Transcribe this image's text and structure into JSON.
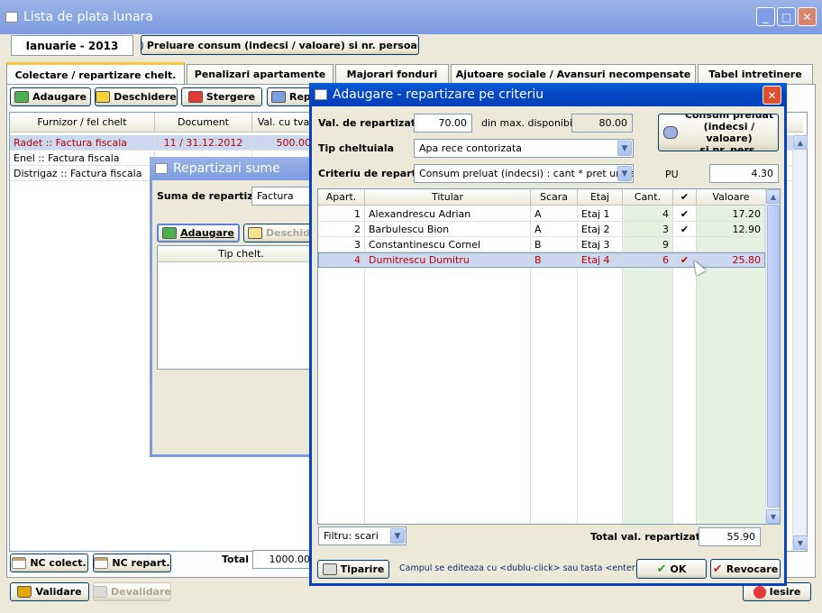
{
  "main_window": {
    "title": "Lista de plata lunara",
    "month": "Ianuarie - 2013",
    "import_button": "Preluare consum (indecsi / valoare) si nr. persoane",
    "tabs": [
      "Colectare / repartizare chelt.",
      "Penalizari apartamente",
      "Majorari fonduri",
      "Ajutoare sociale / Avansuri necompensate",
      "Tabel intretinere"
    ],
    "toolbar": {
      "add": "Adaugare",
      "open": "Deschidere",
      "delete": "Stergere",
      "rep": "Rep"
    },
    "grid": {
      "headers": [
        "Furnizor / fel chelt",
        "Document",
        "Val. cu tva"
      ],
      "rows": [
        {
          "furnizor": "Radet :: Factura fiscala",
          "document": "11 / 31.12.2012",
          "valoare": "500.00"
        },
        {
          "furnizor": "Enel :: Factura fiscala",
          "document": "",
          "valoare": ""
        },
        {
          "furnizor": "Distrigaz :: Factura fiscala",
          "document": "",
          "valoare": ""
        }
      ]
    },
    "bottom": {
      "nc_colect": "NC colect.",
      "nc_repart": "NC repart.",
      "total_label": "Total",
      "total_value": "1000.00",
      "validate": "Validare",
      "devalidate": "Devalidare",
      "exit": "Iesire"
    }
  },
  "sums_dialog": {
    "title": "Repartizari sume",
    "sum_label": "Suma de repartizat",
    "sum_value": "Factura",
    "add": "Adaugare",
    "open": "Deschide",
    "grid_header": "Tip chelt."
  },
  "criteria_dialog": {
    "title": "Adaugare - repartizare pe criteriu",
    "val_label": "Val. de repartizat",
    "val_value": "70.00",
    "max_label": "din max. disponibil",
    "max_value": "80.00",
    "consum_button": "Consum preluat\n(indecsi / valoare)\nsi nr. pers.",
    "tip_label": "Tip cheltuiala",
    "tip_value": "Apa rece contorizata",
    "crit_label": "Criteriu de repart.",
    "crit_value": "Consum preluat (indecsi) : cant * pret unitar",
    "pu_label": "PU",
    "pu_value": "4.30",
    "headers": [
      "Apart.",
      "Titular",
      "Scara",
      "Etaj",
      "Cant.",
      "✔",
      "Valoare"
    ],
    "rows": [
      {
        "apart": "1",
        "titular": "Alexandrescu Adrian",
        "scara": "A",
        "etaj": "Etaj 1",
        "cant": "4",
        "check": "✔",
        "valoare": "17.20"
      },
      {
        "apart": "2",
        "titular": "Barbulescu Bion",
        "scara": "A",
        "etaj": "Etaj 2",
        "cant": "3",
        "check": "✔",
        "valoare": "12.90"
      },
      {
        "apart": "3",
        "titular": "Constantinescu Cornel",
        "scara": "B",
        "etaj": "Etaj 3",
        "cant": "9",
        "check": "",
        "valoare": ""
      },
      {
        "apart": "4",
        "titular": "Dumitrescu Dumitru",
        "scara": "B",
        "etaj": "Etaj 4",
        "cant": "6",
        "check": "✔",
        "valoare": "25.80"
      }
    ],
    "filter_value": "Filtru: scari",
    "total_label": "Total val. repartizata",
    "total_value": "55.90",
    "print": "Tiparire",
    "hint": "Campul se editeaza cu <dublu-click> sau tasta <enter>",
    "ok": "OK",
    "cancel": "Revocare"
  }
}
